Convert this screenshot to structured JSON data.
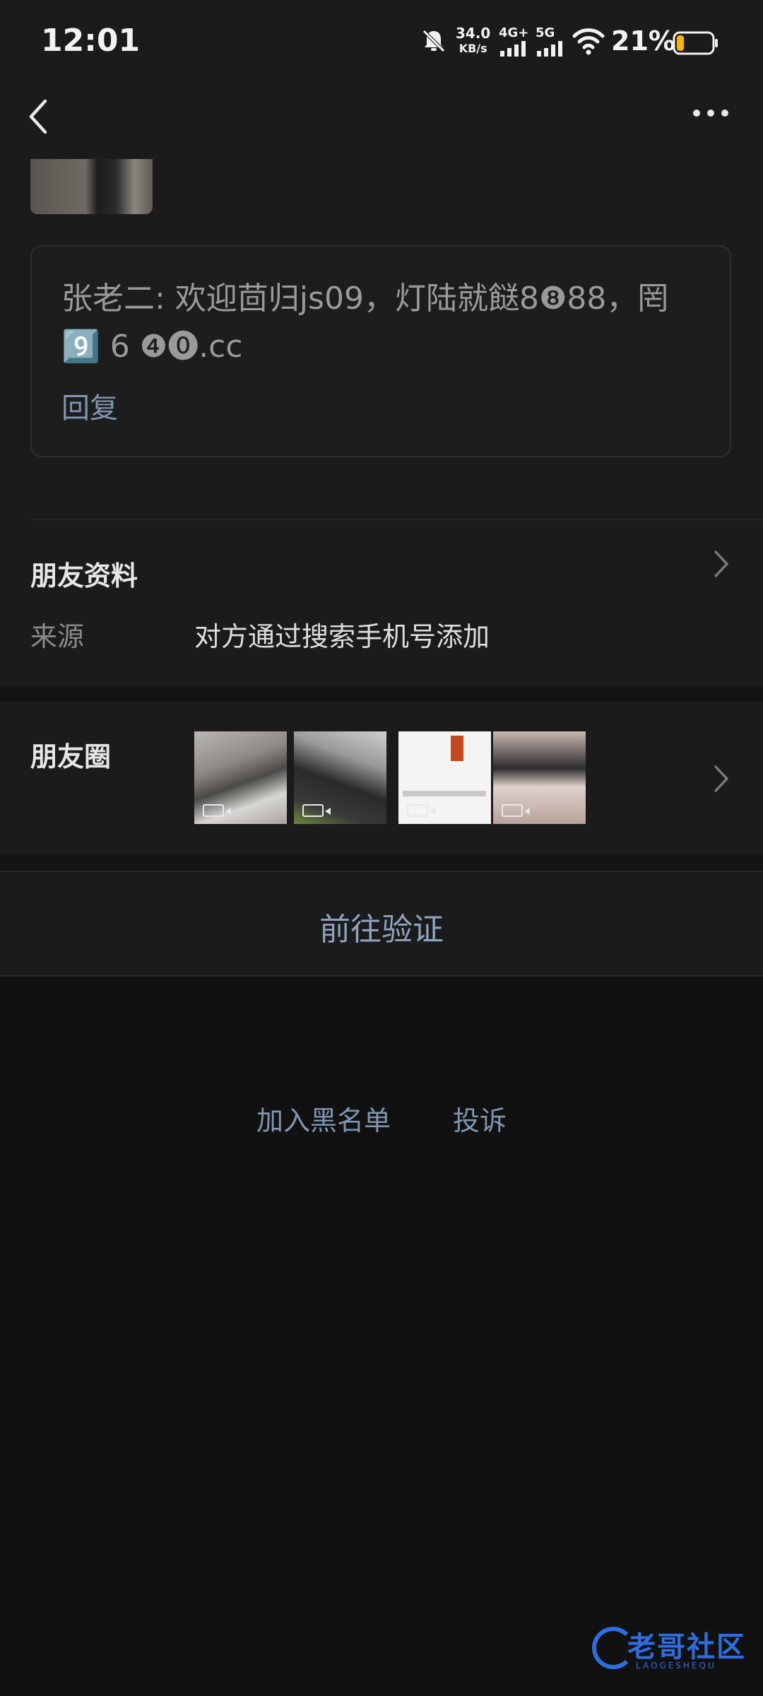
{
  "status_bar": {
    "time": "12:01",
    "net_speed_value": "34.0",
    "net_speed_unit": "KB/s",
    "signal_1": "4G+",
    "signal_2": "5G",
    "battery_percent": "21%",
    "battery_level": 0.21,
    "battery_color": "#f2b705"
  },
  "nav": {
    "back_icon": "chevron-left-icon",
    "more_icon": "more-horizontal-icon"
  },
  "comment": {
    "text": "张老二: 欢迎茴归js09，灯陆就餸8❽88，罔\n9️⃣ 6 ❹⓿.cc",
    "reply_label": "回复"
  },
  "friend_info": {
    "title": "朋友资料",
    "source_label": "来源",
    "source_value": "对方通过搜索手机号添加"
  },
  "moments": {
    "title": "朋友圈",
    "thumbnails": [
      {
        "kind": "video",
        "icon": "video-icon"
      },
      {
        "kind": "video",
        "icon": "video-icon"
      },
      {
        "kind": "video",
        "icon": "video-icon"
      },
      {
        "kind": "video",
        "icon": "video-icon"
      }
    ]
  },
  "actions": {
    "verify": "前往验证",
    "blacklist": "加入黑名单",
    "report": "投诉"
  },
  "watermark": {
    "text": "老哥社区",
    "sub": "LAOGESHEQU"
  },
  "colors": {
    "accent_link": "#7f95b0",
    "background": "#111111",
    "panel": "#1b1b1b"
  }
}
